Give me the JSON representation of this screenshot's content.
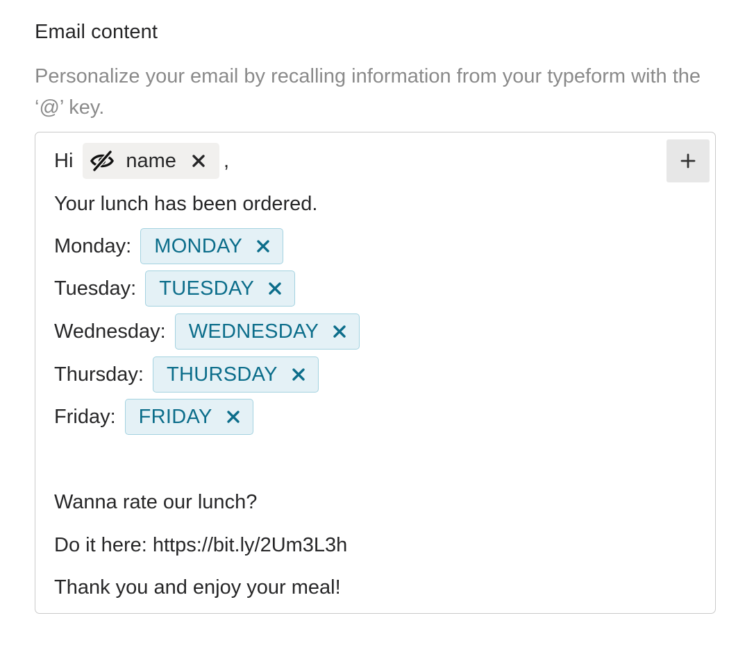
{
  "section": {
    "title": "Email content",
    "description": "Personalize your email by recalling information from your typeform with the ‘@’ key."
  },
  "editor": {
    "greeting_prefix": "Hi",
    "greeting_suffix": ",",
    "hidden_field_tag": {
      "label": "name",
      "icon": "eye-slash-icon",
      "remove_icon": "close-icon"
    },
    "intro_line": "Your lunch has been ordered.",
    "days": [
      {
        "label": "Monday:",
        "tag": "MONDAY"
      },
      {
        "label": "Tuesday:",
        "tag": "TUESDAY"
      },
      {
        "label": "Wednesday:",
        "tag": "WEDNESDAY"
      },
      {
        "label": "Thursday:",
        "tag": "THURSDAY"
      },
      {
        "label": "Friday:",
        "tag": "FRIDAY"
      }
    ],
    "closing_lines": [
      "Wanna rate our lunch?",
      "Do it here: https://bit.ly/2Um3L3h",
      "Thank you and enjoy your meal!"
    ],
    "add_button_icon": "plus-icon"
  },
  "colors": {
    "field_tag_background": "#e4f1f6",
    "field_tag_border": "#a3d2e0",
    "field_tag_text": "#0b6d8a",
    "hidden_tag_background": "#f1f0ee",
    "description_text": "#8a8a8a",
    "editor_border": "#c9c9c9"
  }
}
